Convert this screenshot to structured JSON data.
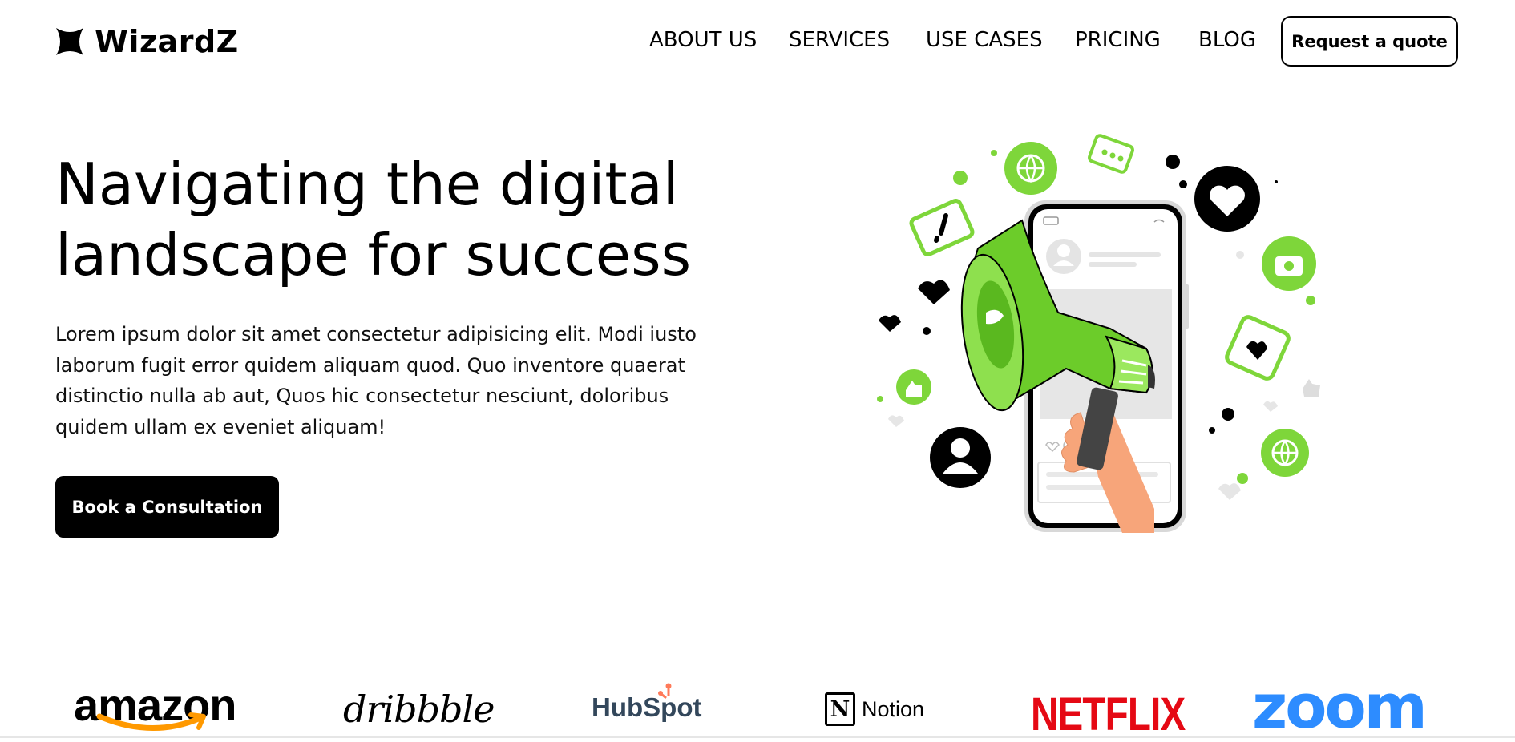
{
  "brand": {
    "name": "WizardZ",
    "icon": "four-point-star-icon"
  },
  "nav": {
    "items": [
      {
        "label": "ABOUT US"
      },
      {
        "label": "SERVICES"
      },
      {
        "label": "USE CASES"
      },
      {
        "label": "PRICING"
      },
      {
        "label": "BLOG"
      }
    ],
    "cta_label": "Request a quote"
  },
  "hero": {
    "title_line1": "Navigating the digital",
    "title_line2": "landscape for success",
    "body": "Lorem ipsum dolor sit amet consectetur adipisicing elit. Modi iusto laborum fugit error quidem aliquam quod. Quo inventore quaerat distinctio nulla ab aut, Quos hic consectetur nesciunt, doloribus quidem ullam ex eveniet aliquam!",
    "cta_label": "Book a Consultation",
    "illustration": "megaphone-phone-illustration"
  },
  "brands": [
    {
      "name": "amazon"
    },
    {
      "name": "dribbble"
    },
    {
      "name": "HubSpot"
    },
    {
      "name": "Notion",
      "mark": "N"
    },
    {
      "name": "NETFLIX"
    },
    {
      "name": "zoom"
    }
  ],
  "colors": {
    "accent_green": "#7ed63a",
    "text": "#000000",
    "netflix_red": "#e50914",
    "zoom_blue": "#2d8cff",
    "hubspot_slate": "#33475b",
    "hubspot_orange": "#ff7a59",
    "amazon_orange": "#ff9900"
  }
}
